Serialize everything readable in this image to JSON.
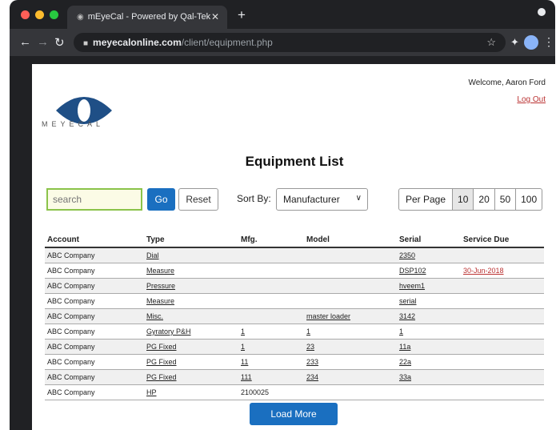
{
  "browser": {
    "tab_title": "mEyeCal - Powered by Qal-Tek",
    "url_domain": "meyecalonline.com",
    "url_path": "/client/equipment.php",
    "traffic_lights": [
      "#ff5f57",
      "#febc2e",
      "#28c840"
    ]
  },
  "header": {
    "logo_text": "MEYECAL",
    "welcome": "Welcome, Aaron Ford",
    "logout": "Log Out"
  },
  "page_title": "Equipment List",
  "controls": {
    "search_placeholder": "search",
    "go_label": "Go",
    "reset_label": "Reset",
    "sort_label": "Sort By:",
    "sort_value": "Manufacturer",
    "per_page_label": "Per Page",
    "per_page_options": [
      "10",
      "20",
      "50",
      "100"
    ],
    "per_page_selected": "10"
  },
  "table": {
    "headers": [
      "Account",
      "Type",
      "Mfg.",
      "Model",
      "Serial",
      "Service Due"
    ],
    "rows": [
      [
        "ABC Company",
        "Dial",
        "",
        "",
        "2350",
        ""
      ],
      [
        "ABC Company",
        "Measure",
        "",
        "",
        "DSP102",
        "30-Jun-2018"
      ],
      [
        "ABC Company",
        "Pressure",
        "",
        "",
        "hveem1",
        ""
      ],
      [
        "ABC Company",
        "Measure",
        "",
        "",
        "serial",
        ""
      ],
      [
        "ABC Company",
        "Misc.",
        "",
        "master loader",
        "3142",
        ""
      ],
      [
        "ABC Company",
        "Gyratory P&H",
        "1",
        "1",
        "1",
        ""
      ],
      [
        "ABC Company",
        "PG Fixed",
        "1",
        "23",
        "11a",
        ""
      ],
      [
        "ABC Company",
        "PG Fixed",
        "11",
        "233",
        "22a",
        ""
      ],
      [
        "ABC Company",
        "PG Fixed",
        "111",
        "234",
        "33a",
        ""
      ],
      [
        "ABC Company",
        "HP",
        "2100025",
        "",
        "",
        ""
      ]
    ]
  },
  "load_more": "Load More",
  "colors": {
    "accent": "#1a6fc0",
    "due_text": "#b33333",
    "logo_blue": "#1f4f86"
  }
}
